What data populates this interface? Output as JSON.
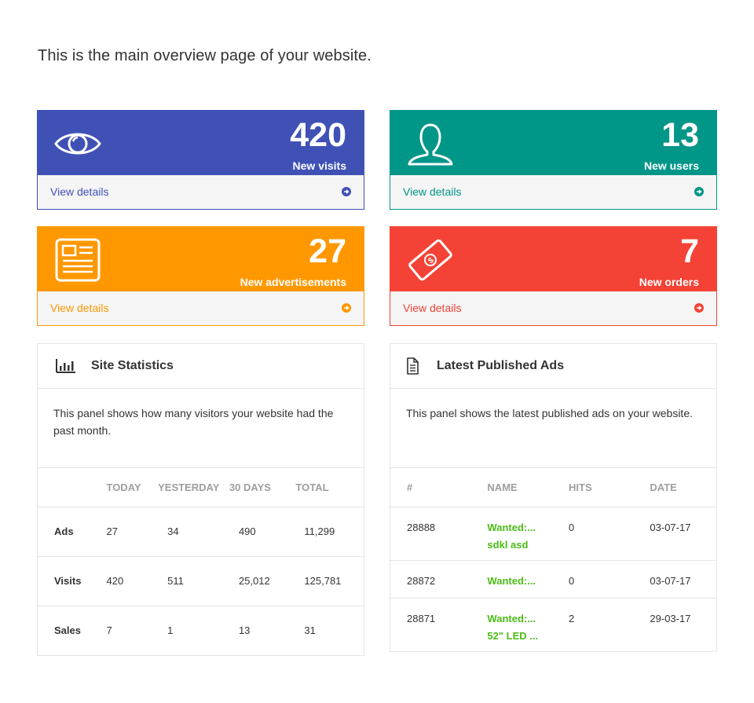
{
  "intro": "This is the main overview page of your website.",
  "cards": [
    {
      "value": "420",
      "label": "New visits",
      "link": "View details",
      "icon": "eye-icon",
      "color": "#3f51b5"
    },
    {
      "value": "13",
      "label": "New users",
      "link": "View details",
      "icon": "user-icon",
      "color": "#009688"
    },
    {
      "value": "27",
      "label": "New advertisements",
      "link": "View details",
      "icon": "newspaper-icon",
      "color": "#ff9800"
    },
    {
      "value": "7",
      "label": "New orders",
      "link": "View details",
      "icon": "money-icon",
      "color": "#f44336"
    }
  ],
  "stats_panel": {
    "title": "Site Statistics",
    "icon": "bar-chart-icon",
    "description": "This panel shows how many visitors your website had the past month.",
    "columns": [
      "",
      "TODAY",
      "YESTERDAY",
      "30 DAYS",
      "TOTAL"
    ],
    "rows": [
      {
        "label": "Ads",
        "today": "27",
        "yesterday": "34",
        "days30": "490",
        "total": "11,299"
      },
      {
        "label": "Visits",
        "today": "420",
        "yesterday": "511",
        "days30": "25,012",
        "total": "125,781"
      },
      {
        "label": "Sales",
        "today": "7",
        "yesterday": "1",
        "days30": "13",
        "total": "31"
      }
    ]
  },
  "ads_panel": {
    "title": "Latest Published Ads",
    "icon": "document-icon",
    "description": "This panel shows the latest published ads on your website.",
    "columns": [
      "#",
      "NAME",
      "HITS",
      "DATE"
    ],
    "rows": [
      {
        "id": "28888",
        "name1": "Wanted:...",
        "name2": "sdkl asd",
        "hits": "0",
        "date": "03-07-17"
      },
      {
        "id": "28872",
        "name1": "Wanted:...",
        "name2": "",
        "hits": "0",
        "date": "03-07-17"
      },
      {
        "id": "28871",
        "name1": "Wanted:...",
        "name2": "52\" LED ...",
        "hits": "2",
        "date": "29-03-17"
      }
    ]
  }
}
